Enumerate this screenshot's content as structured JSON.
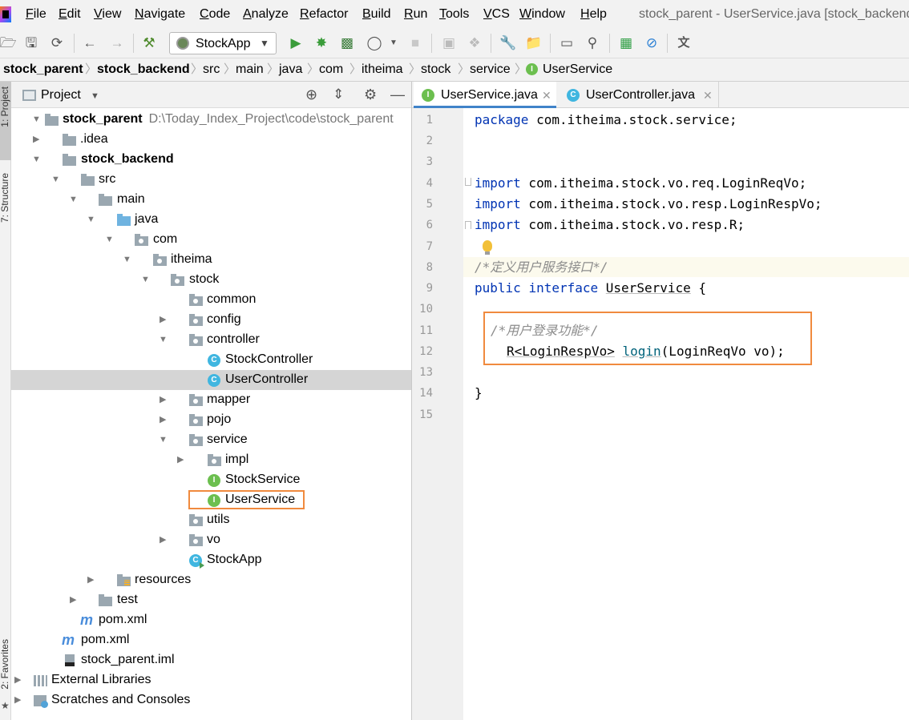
{
  "menu": [
    "File",
    "Edit",
    "View",
    "Navigate",
    "Code",
    "Analyze",
    "Refactor",
    "Build",
    "Run",
    "Tools",
    "VCS",
    "Window",
    "Help"
  ],
  "window_title": "stock_parent - UserService.java [stock_backend",
  "toolbar": {
    "run_config_label": "StockApp",
    "icons": [
      "open-folder-icon",
      "save-icon",
      "sync-icon",
      "back-arrow-icon",
      "forward-arrow-icon",
      "build-hammer-icon",
      "run-icon",
      "debug-icon",
      "coverage-icon",
      "profile-icon",
      "stop-icon",
      "update-icon",
      "deploy-icon",
      "settings-wrench-icon",
      "project-structure-icon",
      "terminal-icon",
      "search-icon",
      "statistic-icon",
      "no-entry-icon",
      "translate-icon"
    ]
  },
  "breadcrumb": [
    "stock_parent",
    "stock_backend",
    "src",
    "main",
    "java",
    "com",
    "itheima",
    "stock",
    "service",
    "UserService"
  ],
  "project_panel": {
    "title": "Project",
    "tree": [
      {
        "label": "stock_parent",
        "path": "D:\\Today_Index_Project\\code\\stock_parent",
        "bold": true
      },
      {
        "label": ".idea"
      },
      {
        "label": "stock_backend",
        "bold": true
      },
      {
        "label": "src"
      },
      {
        "label": "main"
      },
      {
        "label": "java"
      },
      {
        "label": "com"
      },
      {
        "label": "itheima"
      },
      {
        "label": "stock"
      },
      {
        "label": "common"
      },
      {
        "label": "config"
      },
      {
        "label": "controller"
      },
      {
        "label": "StockController"
      },
      {
        "label": "UserController"
      },
      {
        "label": "mapper"
      },
      {
        "label": "pojo"
      },
      {
        "label": "service"
      },
      {
        "label": "impl"
      },
      {
        "label": "StockService"
      },
      {
        "label": "UserService"
      },
      {
        "label": "utils"
      },
      {
        "label": "vo"
      },
      {
        "label": "StockApp"
      },
      {
        "label": "resources"
      },
      {
        "label": "test"
      },
      {
        "label": "pom.xml"
      },
      {
        "label": "pom.xml"
      },
      {
        "label": "stock_parent.iml"
      },
      {
        "label": "External Libraries"
      },
      {
        "label": "Scratches and Consoles"
      }
    ]
  },
  "side_tabs": [
    "1: Project",
    "7: Structure",
    "2: Favorites"
  ],
  "editor": {
    "tabs": [
      {
        "label": "UserService.java",
        "type": "I"
      },
      {
        "label": "UserController.java",
        "type": "C"
      }
    ],
    "line_numbers": [
      "1",
      "2",
      "3",
      "4",
      "5",
      "6",
      "7",
      "8",
      "9",
      "10",
      "11",
      "12",
      "13",
      "14",
      "15"
    ],
    "code": {
      "l1_kw": "package",
      "l1_rest": " com.itheima.stock.service;",
      "l4_kw": "import",
      "l4_rest": " com.itheima.stock.vo.req.LoginReqVo;",
      "l5_kw": "import",
      "l5_rest": " com.itheima.stock.vo.resp.LoginRespVo;",
      "l6_kw": "import",
      "l6_rest": " com.itheima.stock.vo.resp.R;",
      "l8_comment": "/*定义用户服务接口*/",
      "l9_kw1": "public",
      "l9_kw2": "interface",
      "l9_name": "UserService",
      "l9_rest": " {",
      "l11_comment": "/*用户登录功能*/",
      "l12_type": "R<LoginRespVo>",
      "l12_method": "login",
      "l12_rest": "(LoginReqVo vo);",
      "l14": "}"
    }
  }
}
